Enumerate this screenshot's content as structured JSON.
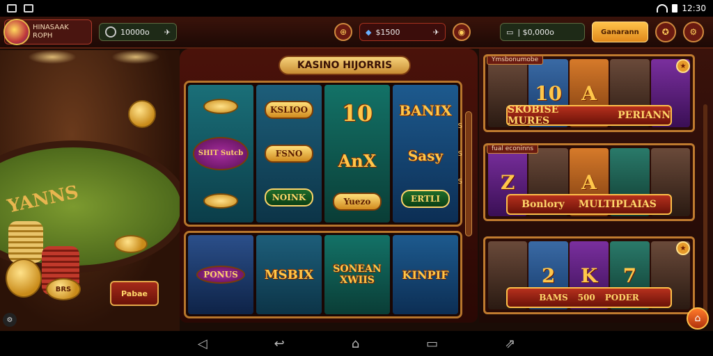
{
  "status_bar": {
    "time": "12:30"
  },
  "header": {
    "profile_name": "HINASAAK",
    "profile_sub": "ROPH",
    "balance_1": "10000o",
    "balance_2": "$1500",
    "balance_3": "| $0,000o",
    "cta_label": "Ganarann"
  },
  "table": {
    "felt_text": "YANNS",
    "sign": "Pabae",
    "chip_label": "BRS"
  },
  "slot": {
    "title": "KASINO HIJORRIS",
    "reel1": [
      "",
      "SHIT Sutcb",
      ""
    ],
    "reel2": [
      "KSLIOO",
      "FSNO",
      "NOINK"
    ],
    "reel3": [
      "10",
      "AnX",
      "Yuezo"
    ],
    "reel4": [
      "BANIX",
      "Sasy",
      "ERTLI"
    ],
    "row2": [
      "PONUS",
      "MSBIX",
      "SONEAN XWIIS",
      "KINPIF"
    ],
    "side_marks": [
      "S",
      "S",
      "S"
    ]
  },
  "games": {
    "card1": {
      "label": "Ymsbonumobe",
      "tiles": [
        "",
        "10",
        "A",
        "",
        ""
      ],
      "banner": [
        "SKOBISE MURES",
        "PERIANN"
      ]
    },
    "card2": {
      "label": "fual econinns",
      "tiles": [
        "Z",
        "",
        "A",
        "",
        ""
      ],
      "banner": [
        "Bonlory",
        "MULTIPLAIAS"
      ]
    },
    "card3": {
      "label": "",
      "tiles": [
        "",
        "2",
        "K",
        "7",
        ""
      ],
      "banner": [
        "BAMS",
        "500",
        "PODER"
      ]
    }
  }
}
